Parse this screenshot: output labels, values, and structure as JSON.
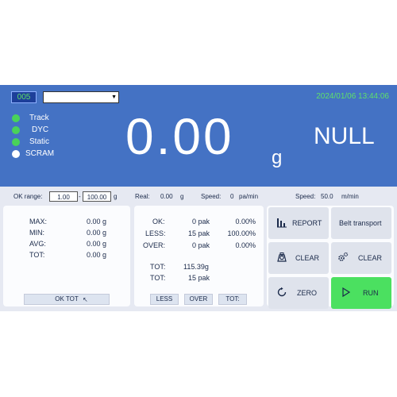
{
  "header": {
    "device_id": "005",
    "dropdown_value": "",
    "datetime": "2024/01/06 13:44:06"
  },
  "status": [
    {
      "label": "Track",
      "color": "#49d25a"
    },
    {
      "label": "DYC",
      "color": "#49d25a"
    },
    {
      "label": "Static",
      "color": "#49d25a"
    },
    {
      "label": "SCRAM",
      "color": "#ffffff"
    }
  ],
  "display": {
    "weight": "0.00",
    "unit": "g",
    "result": "NULL"
  },
  "infobar": {
    "ok_range_label": "OK range:",
    "ok_range_low": "1.00",
    "separator": "-",
    "ok_range_high": "100.00",
    "ok_range_unit": "g",
    "real_label": "Real:",
    "real_value": "0.00",
    "real_unit": "g",
    "speed_label": "Speed:",
    "speed_value": "0",
    "speed_unit": "pa/min",
    "speed2_label": "Speed:",
    "speed2_value": "50.0",
    "speed2_unit": "m/min"
  },
  "stats": {
    "rows": [
      {
        "label": "MAX:",
        "value": "0.00 g"
      },
      {
        "label": "MIN:",
        "value": "0.00 g"
      },
      {
        "label": "AVG:",
        "value": "0.00 g"
      },
      {
        "label": "TOT:",
        "value": "0.00 g"
      }
    ],
    "button": "OK TOT"
  },
  "counts": {
    "rows": [
      {
        "label": "OK:",
        "count": "0 pak",
        "percent": "0.00%"
      },
      {
        "label": "LESS:",
        "count": "15 pak",
        "percent": "100.00%"
      },
      {
        "label": "OVER:",
        "count": "0 pak",
        "percent": "0.00%"
      }
    ],
    "tot_weight_label": "TOT:",
    "tot_weight": "115.39g",
    "tot_count_label": "TOT:",
    "tot_count": "15 pak",
    "buttons": [
      "LESS",
      "OVER",
      "TOT:"
    ]
  },
  "actions": {
    "report": "REPORT",
    "belt": "Belt transport",
    "clear1": "CLEAR",
    "clear2": "CLEAR",
    "zero": "ZERO",
    "run": "RUN"
  },
  "colors": {
    "header_bg": "#4472c4",
    "screen_bg": "#e6e9f2",
    "status_green": "#49d25a",
    "run_green": "#4be060",
    "datetime_green": "#5fe06a"
  }
}
